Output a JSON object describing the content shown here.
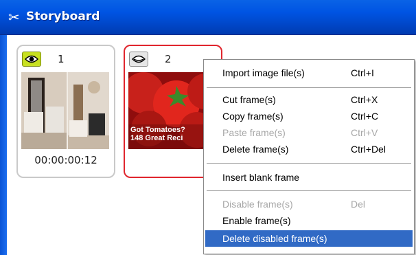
{
  "window": {
    "title": "Storyboard"
  },
  "frames": [
    {
      "number": "1",
      "timecode": "00:00:00:12",
      "visible": true
    },
    {
      "number": "2",
      "timecode": "",
      "visible": false,
      "thumb_text_line1": "Got Tomatoes?",
      "thumb_text_line2": "148 Great Reci"
    }
  ],
  "menu": {
    "items": [
      {
        "label": "Import image file(s)",
        "shortcut": "Ctrl+I",
        "enabled": true
      },
      {
        "label": "Cut frame(s)",
        "shortcut": "Ctrl+X",
        "enabled": true
      },
      {
        "label": "Copy frame(s)",
        "shortcut": "Ctrl+C",
        "enabled": true
      },
      {
        "label": "Paste frame(s)",
        "shortcut": "Ctrl+V",
        "enabled": false
      },
      {
        "label": "Delete frame(s)",
        "shortcut": "Ctrl+Del",
        "enabled": true
      },
      {
        "label": "Insert blank frame",
        "shortcut": "",
        "enabled": true
      },
      {
        "label": "Disable frame(s)",
        "shortcut": "Del",
        "enabled": false
      },
      {
        "label": "Enable frame(s)",
        "shortcut": "",
        "enabled": true
      },
      {
        "label": "Delete disabled frame(s)",
        "shortcut": "",
        "enabled": true,
        "highlighted": true
      }
    ]
  },
  "colors": {
    "titlebar": "#0054e3",
    "selected_frame_border": "#e0252d",
    "menu_highlight": "#316ac5",
    "visible_eye": "#c8e020"
  },
  "icons": {
    "title": "scissors-icon",
    "frame_visible": "eye-open-icon",
    "frame_hidden": "eye-closed-icon"
  }
}
